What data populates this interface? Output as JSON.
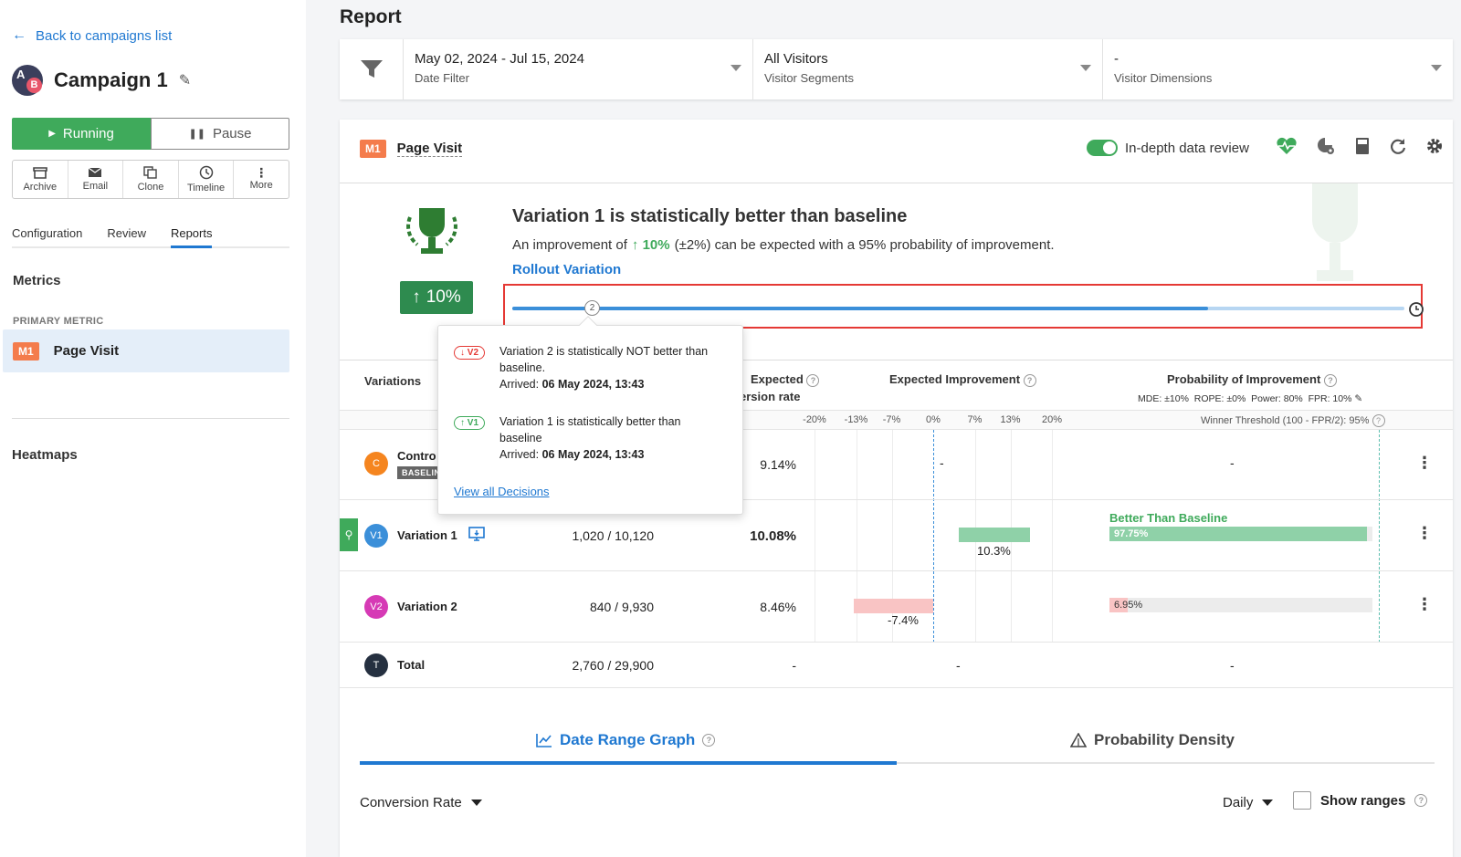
{
  "nav": {
    "back_label": "Back to campaigns list"
  },
  "campaign": {
    "avatar_a": "A",
    "avatar_b": "B",
    "name": "Campaign 1"
  },
  "status": {
    "running_label": "Running",
    "pause_label": "Pause"
  },
  "actions": [
    {
      "label": "Archive",
      "icon": "archive-icon"
    },
    {
      "label": "Email",
      "icon": "email-icon"
    },
    {
      "label": "Clone",
      "icon": "clone-icon"
    },
    {
      "label": "Timeline",
      "icon": "timeline-icon"
    },
    {
      "label": "More",
      "icon": "more-icon"
    }
  ],
  "tabs": {
    "configuration": "Configuration",
    "review": "Review",
    "reports": "Reports"
  },
  "sidebar": {
    "metrics_title": "Metrics",
    "primary_metric_caption": "PRIMARY METRIC",
    "metric_badge": "M1",
    "metric_name": "Page Visit",
    "heatmaps_title": "Heatmaps"
  },
  "page_title": "Report",
  "filters": {
    "date_value": "May 02, 2024 - Jul 15, 2024",
    "date_label": "Date Filter",
    "segment_value": "All Visitors",
    "segment_label": "Visitor Segments",
    "dimension_value": "-",
    "dimension_label": "Visitor Dimensions"
  },
  "metric_panel": {
    "badge": "M1",
    "name": "Page Visit",
    "toggle_label": "In-depth data review"
  },
  "result": {
    "lift_badge": "10%",
    "headline": "Variation 1 is statistically better than baseline",
    "desc_prefix": "An improvement of",
    "desc_lift": "10%",
    "desc_suffix": "(±2%) can be expected with a 95% probability of improvement.",
    "rollout_label": "Rollout Variation",
    "timeline_marker": "2",
    "timeline_progress": 0.78
  },
  "tooltip": {
    "items": [
      {
        "badge": "V2",
        "text": "Variation 2 is statistically NOT better than baseline.",
        "arrived_prefix": "Arrived:",
        "arrived": "06 May 2024, 13:43"
      },
      {
        "badge": "V1",
        "text": "Variation 1 is statistically better than baseline",
        "arrived_prefix": "Arrived:",
        "arrived": "06 May 2024, 13:43"
      }
    ],
    "link": "View all Decisions"
  },
  "table": {
    "headers": {
      "variations": "Variations",
      "expected_cr_1": "Expected",
      "expected_cr_2": "ersion rate",
      "expected_improvement": "Expected Improvement",
      "probability": "Probability of Improvement",
      "prob_meta": "MDE: ±10%  ROPE: ±0%  Power: 80%  FPR: 10%",
      "winner_threshold": "Winner Threshold (100 - FPR/2): 95%"
    },
    "axis_ticks": [
      "-20%",
      "-13%",
      "-7%",
      "0%",
      "7%",
      "13%",
      "20%"
    ],
    "rows": [
      {
        "icon": "C",
        "name": "Contro",
        "baseline": "BASELIN",
        "conversions": "",
        "rate": "9.14%",
        "improvement": "-",
        "improvement_value": null,
        "probability": "-",
        "probability_value": null,
        "color": "#f5851f"
      },
      {
        "icon": "V1",
        "name": "Variation 1",
        "conversions": "1,020 / 10,120",
        "rate": "10.08%",
        "improvement": "10.3%",
        "improvement_value": 10.3,
        "probability_label": "Better Than Baseline",
        "probability": "97.75%",
        "probability_value": 97.75,
        "color": "#3b8fd9"
      },
      {
        "icon": "V2",
        "name": "Variation 2",
        "conversions": "840 / 9,930",
        "rate": "8.46%",
        "improvement": "-7.4%",
        "improvement_value": -7.4,
        "probability": "6.95%",
        "probability_value": 6.95,
        "color": "#d63ab5"
      }
    ],
    "total": {
      "icon": "T",
      "name": "Total",
      "conversions": "2,760 / 29,900",
      "rate": "-",
      "improvement": "-",
      "probability": "-"
    }
  },
  "graph_tabs": {
    "date_range": "Date Range Graph",
    "probability_density": "Probability Density"
  },
  "graph_controls": {
    "metric": "Conversion Rate",
    "period": "Daily",
    "show_ranges": "Show ranges"
  },
  "colors": {
    "accent": "#1f78d1",
    "green": "#3faa5b",
    "orange": "#f47c4c",
    "red_highlight": "#e53935"
  }
}
